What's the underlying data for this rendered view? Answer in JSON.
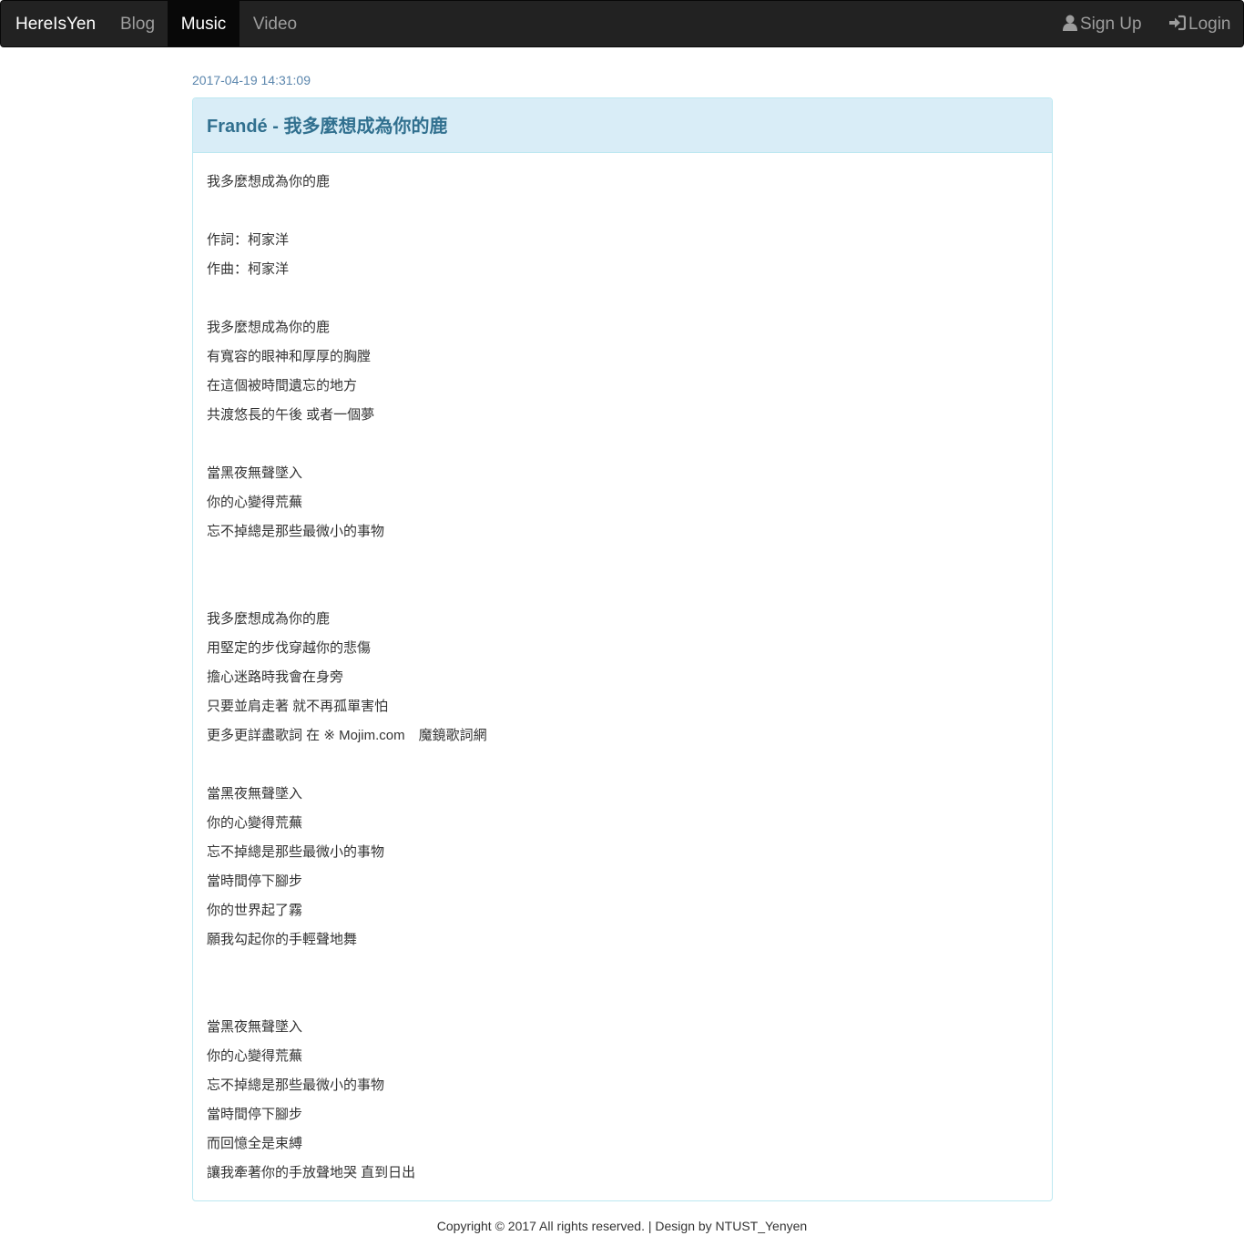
{
  "navbar": {
    "brand": "HereIsYen",
    "links": [
      "Blog",
      "Music",
      "Video"
    ],
    "active": "Music",
    "signup_label": "Sign Up",
    "login_label": "Login",
    "signup_icon": "user-icon",
    "login_icon": "login-icon"
  },
  "post": {
    "timestamp": "2017-04-19 14:31:09",
    "title": "Frandé - 我多麼想成為你的鹿",
    "lyrics": [
      "我多麼想成為你的鹿",
      "",
      "作詞：柯家洋",
      "作曲：柯家洋",
      "",
      "我多麼想成為你的鹿",
      "有寬容的眼神和厚厚的胸膛",
      "在這個被時間遺忘的地方",
      "共渡悠長的午後 或者一個夢",
      "",
      "當黑夜無聲墜入",
      "你的心變得荒蕪",
      "忘不掉總是那些最微小的事物",
      "",
      "",
      "我多麼想成為你的鹿",
      "用堅定的步伐穿越你的悲傷",
      "擔心迷路時我會在身旁",
      "只要並肩走著 就不再孤單害怕",
      "更多更詳盡歌詞 在 ※ Mojim.com　魔鏡歌詞網",
      "",
      "當黑夜無聲墜入",
      "你的心變得荒蕪",
      "忘不掉總是那些最微小的事物",
      "當時間停下腳步",
      "你的世界起了霧",
      "願我勾起你的手輕聲地舞",
      "",
      "",
      "當黑夜無聲墜入",
      "你的心變得荒蕪",
      "忘不掉總是那些最微小的事物",
      "當時間停下腳步",
      "而回憶全是束縛",
      "讓我牽著你的手放聲地哭 直到日出"
    ]
  },
  "footer": {
    "text": "Copyright © 2017 All rights reserved. | Design by NTUST_Yenyen"
  }
}
